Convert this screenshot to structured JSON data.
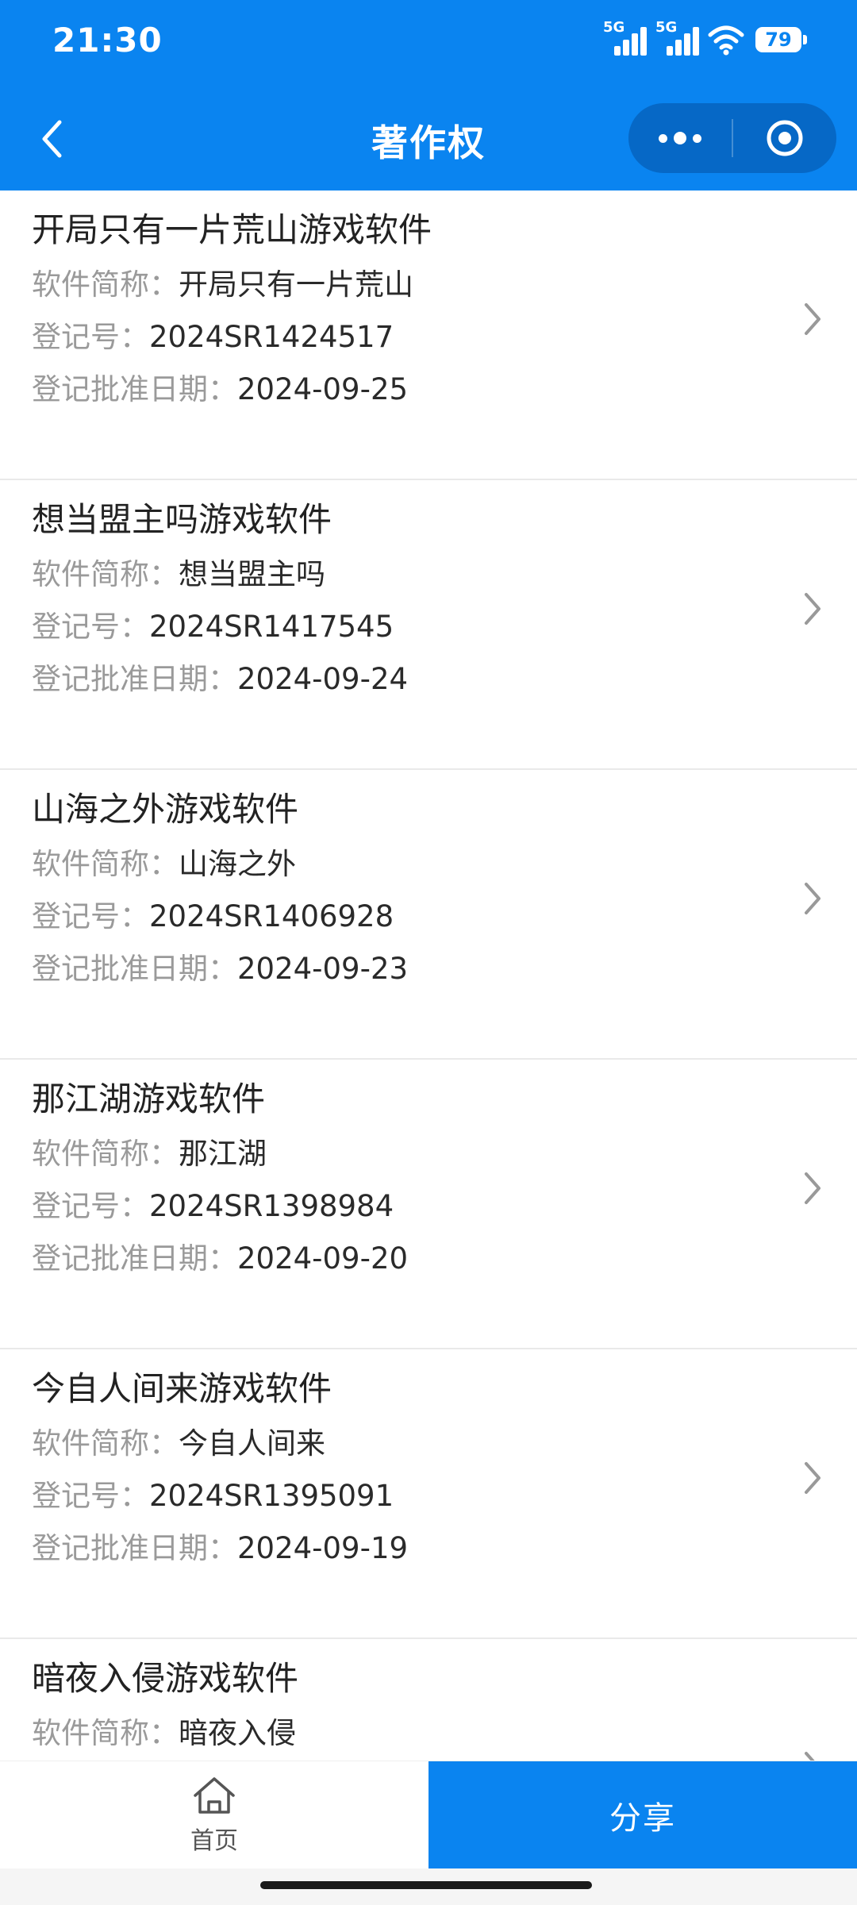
{
  "status_bar": {
    "time": "21:30",
    "sim1_tag": "5G",
    "sim2_tag": "5G",
    "battery_level": "79"
  },
  "nav": {
    "title": "著作权"
  },
  "labels": {
    "short_name": "软件简称：",
    "reg_no": "登记号：",
    "approval_date": "登记批准日期："
  },
  "items": [
    {
      "title": "开局只有一片荒山游戏软件",
      "short_name": "开局只有一片荒山",
      "reg_no": "2024SR1424517",
      "approval_date": "2024-09-25"
    },
    {
      "title": "想当盟主吗游戏软件",
      "short_name": "想当盟主吗",
      "reg_no": "2024SR1417545",
      "approval_date": "2024-09-24"
    },
    {
      "title": "山海之外游戏软件",
      "short_name": "山海之外",
      "reg_no": "2024SR1406928",
      "approval_date": "2024-09-23"
    },
    {
      "title": "那江湖游戏软件",
      "short_name": "那江湖",
      "reg_no": "2024SR1398984",
      "approval_date": "2024-09-20"
    },
    {
      "title": "今自人间来游戏软件",
      "short_name": "今自人间来",
      "reg_no": "2024SR1395091",
      "approval_date": "2024-09-19"
    },
    {
      "title": "暗夜入侵游戏软件",
      "short_name": "暗夜入侵",
      "reg_no": "",
      "approval_date": ""
    }
  ],
  "bottom_bar": {
    "home_label": "首页",
    "share_label": "分享"
  },
  "colors": {
    "accent": "#0a84f0",
    "capsule": "#0668c6"
  }
}
